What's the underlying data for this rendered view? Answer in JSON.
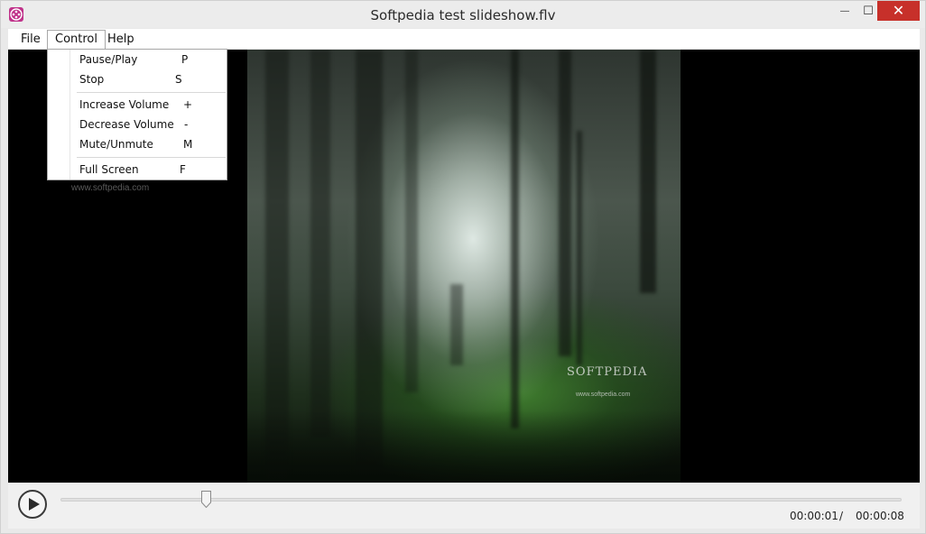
{
  "window": {
    "title": "Softpedia test slideshow.flv",
    "close_glyph": "✕",
    "minimize_glyph": "—",
    "maximize_glyph": "☐"
  },
  "menubar": {
    "file": "File",
    "control": "Control",
    "help": "Help"
  },
  "control_menu": {
    "items": [
      {
        "label": "Pause/Play",
        "key": "P"
      },
      {
        "label": "Stop",
        "key": "S"
      },
      {
        "label": "Increase Volume",
        "key": "+"
      },
      {
        "label": "Decrease Volume",
        "key": "-"
      },
      {
        "label": "Mute/Unmute",
        "key": "M"
      },
      {
        "label": "Full Screen",
        "key": "F"
      }
    ]
  },
  "video": {
    "watermark_text": "SOFTPEDIA",
    "watermark_url": "www.softpedia.com"
  },
  "player": {
    "current_time": "00:00:01",
    "separator": "/",
    "total_time": "00:00:08",
    "progress_fraction": 0.125
  },
  "colors": {
    "close_button": "#c7302a",
    "app_icon": "#c0328a"
  }
}
